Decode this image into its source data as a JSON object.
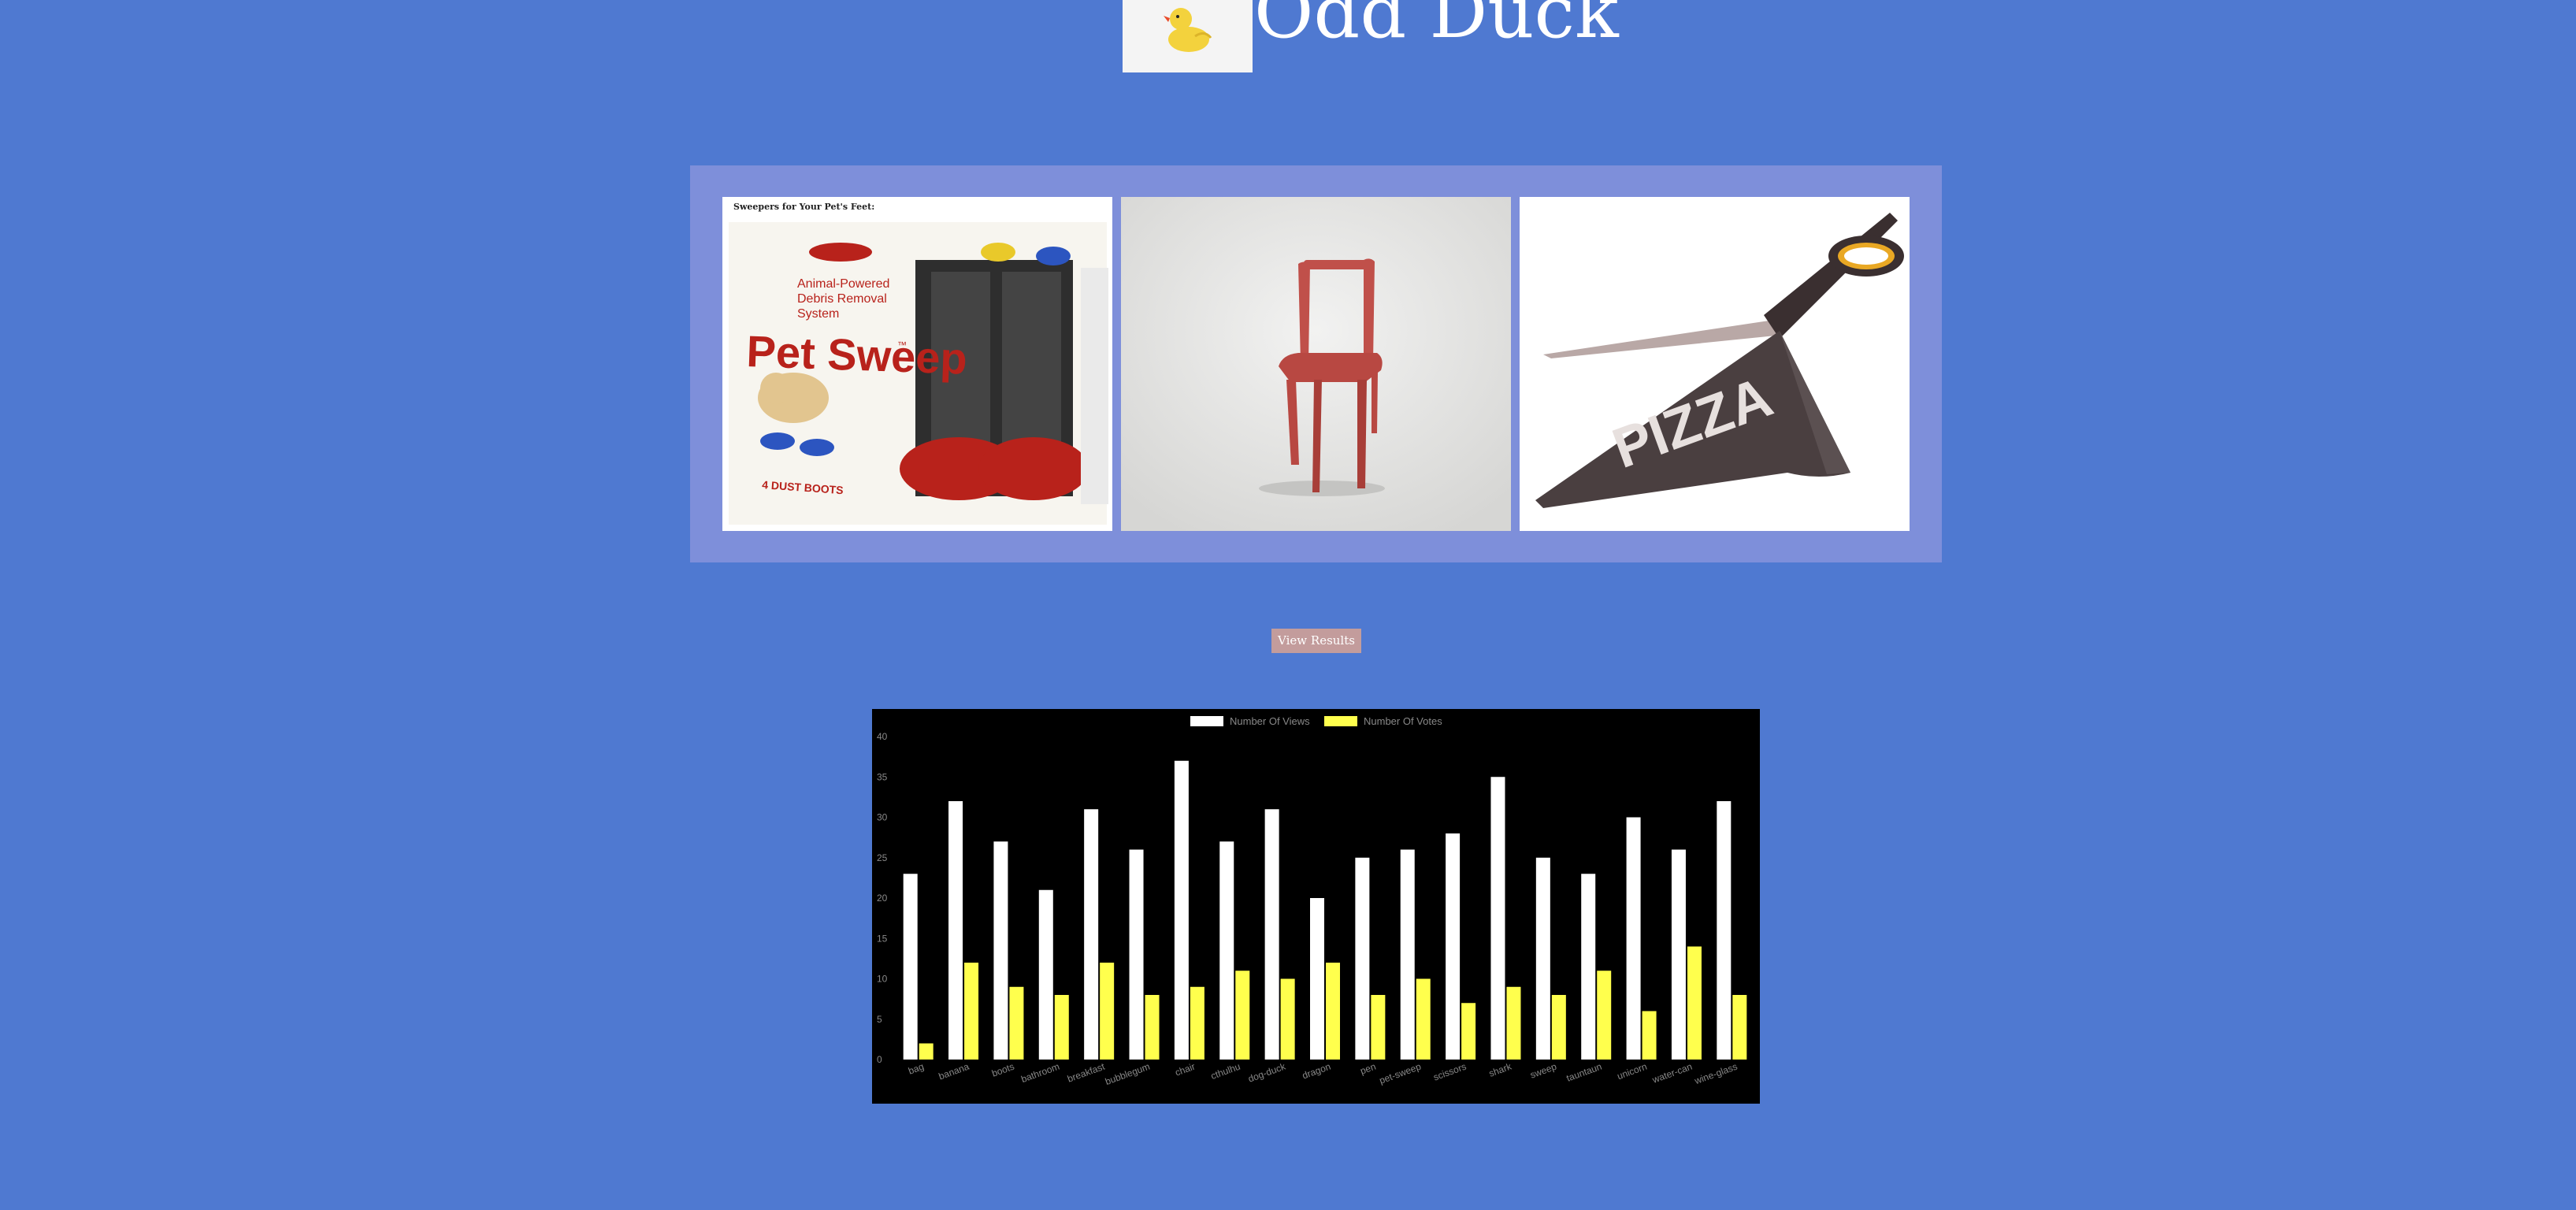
{
  "header": {
    "title": "Odd Duck",
    "logo_icon": "rubber-duck-icon"
  },
  "products": [
    {
      "name": "pet-sweep",
      "label_banner": "Sweepers for Your Pet's Feet:",
      "box_brand": "Pet Sweep",
      "box_tm": "™",
      "box_tagline": [
        "Animal-Powered",
        "Debris Removal",
        "System"
      ],
      "box_count": "4 DUST BOOTS"
    },
    {
      "name": "chair",
      "icon": "red-chair-image"
    },
    {
      "name": "scissors",
      "icon": "pizza-scissors-image",
      "imprint": "PIZZA"
    }
  ],
  "results_button": "View Results",
  "chart_data": {
    "type": "bar",
    "categories": [
      "bag",
      "banana",
      "boots",
      "bathroom",
      "breakfast",
      "bubblegum",
      "chair",
      "cthulhu",
      "dog-duck",
      "dragon",
      "pen",
      "pet-sweep",
      "scissors",
      "shark",
      "sweep",
      "tauntaun",
      "unicorn",
      "water-can",
      "wine-glass"
    ],
    "series": [
      {
        "name": "Number Of Views",
        "color": "#ffffff",
        "values": [
          23,
          32,
          27,
          21,
          31,
          26,
          37,
          27,
          31,
          20,
          25,
          26,
          28,
          35,
          25,
          23,
          30,
          26,
          32
        ]
      },
      {
        "name": "Number Of Votes",
        "color": "#ffff4d",
        "values": [
          2,
          12,
          9,
          8,
          12,
          8,
          9,
          11,
          10,
          12,
          8,
          10,
          7,
          9,
          8,
          11,
          6,
          14,
          8
        ]
      }
    ],
    "yticks": [
      0,
      5,
      10,
      15,
      20,
      25,
      30,
      35,
      40
    ],
    "ylim": [
      0,
      40
    ],
    "grid": false,
    "legend": "top-center"
  }
}
